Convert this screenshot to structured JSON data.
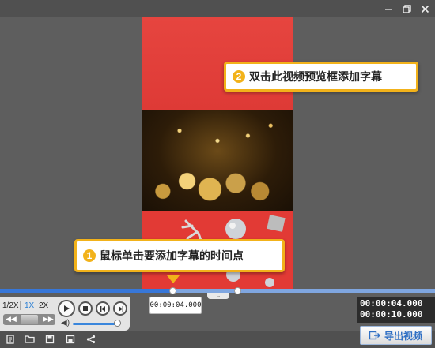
{
  "window": {
    "controls": [
      "minimize-icon",
      "restore-icon",
      "close-icon"
    ]
  },
  "callouts": {
    "step2": {
      "number": "2",
      "text": "双击此视频预览框添加字幕"
    },
    "step1": {
      "number": "1",
      "text": "鼠标单击要添加字幕的时间点"
    }
  },
  "timeline": {
    "tooltip_time": "00:00:04.000",
    "progress": 0.4
  },
  "playback": {
    "speeds": [
      "1/2X",
      "1X",
      "2X"
    ],
    "active_speed": "1X",
    "volume": 0.9
  },
  "readout": {
    "current": "00:00:04.000",
    "total": "00:00:10.000"
  },
  "toolbar": {
    "icons": [
      "new-project-icon",
      "open-folder-icon",
      "save-icon",
      "save-as-icon",
      "share-icon"
    ],
    "export_label": "导出视频"
  },
  "colors": {
    "accent": "#f2b21a",
    "timeline": "#3777d9",
    "export_text": "#2f6fc4"
  }
}
